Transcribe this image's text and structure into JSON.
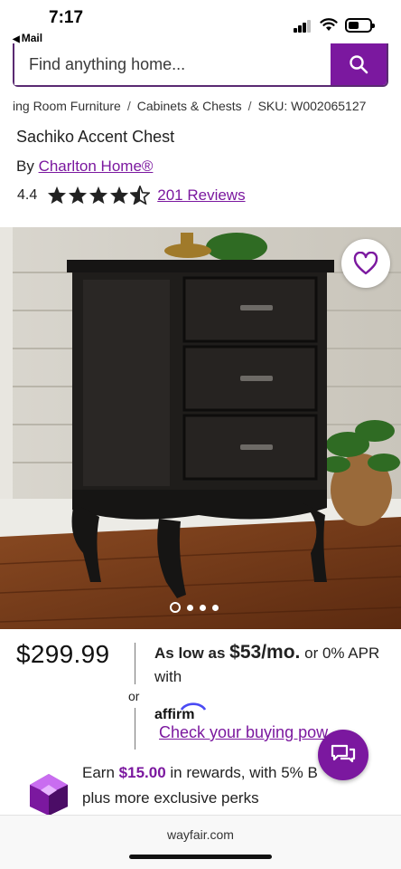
{
  "status_bar": {
    "time": "7:17",
    "back_label": "Mail"
  },
  "search": {
    "placeholder": "Find anything home..."
  },
  "breadcrumb": [
    "ing Room Furniture",
    "Cabinets & Chests",
    "SKU: W002065127"
  ],
  "product": {
    "title": "Sachiko Accent Chest",
    "by_prefix": "By",
    "brand": "Charlton Home®",
    "rating": "4.4",
    "rating_stars": 4.4,
    "reviews": "201 Reviews"
  },
  "gallery": {
    "slide_count": 4,
    "active_index": 0
  },
  "pricing": {
    "price": "$299.99",
    "or": "or",
    "as_low_as": "As low as",
    "monthly": "$53/mo.",
    "apr_text": "or 0% APR with",
    "affirm_brand": "affirm",
    "buying_power_link": "Check your buying pow"
  },
  "rewards": {
    "earn": "Earn",
    "amount": "$15.00",
    "rest": "in rewards, with 5% B",
    "line2": "plus more exclusive perks"
  },
  "browser": {
    "url": "wayfair.com"
  },
  "colors": {
    "brand_purple": "#7b189f",
    "text": "#222222"
  }
}
